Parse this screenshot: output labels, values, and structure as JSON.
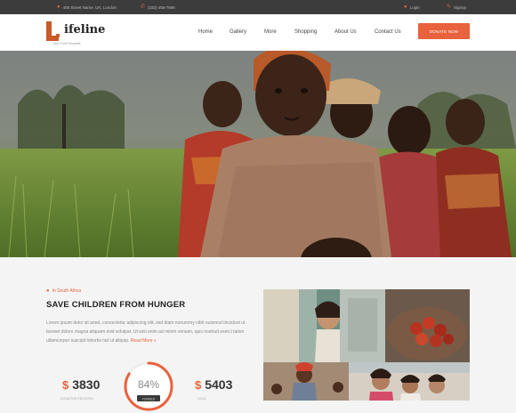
{
  "topbar": {
    "address": "405 Street Name, UK, London",
    "phone": "(333) 455-7866",
    "login": "Login",
    "signup": "Signup"
  },
  "header": {
    "logo_letter": "L",
    "brand": "ifeline",
    "tagline": "Non Profit Template",
    "nav": [
      "Home",
      "Gallery",
      "More",
      "Shopping",
      "About Us",
      "Contact Us"
    ],
    "donate": "DONATE NOW"
  },
  "content": {
    "location": "In South Africa",
    "title": "SAVE CHILDREN FROM HUNGER",
    "paragraph": "Lorem ipsum dolor sit amet, consectetur adipiscing elit, sed diam nonummy nibh euismod tincidunt ut laoreet dolore magna aliquam erat volutpat. Ut wisi enim ad minim veniam, quis nostrud exerci tation ullamcorper suscipit lobortis nisl ut aliquip.",
    "read_more": "Read More »",
    "stats": [
      {
        "currency": "$",
        "value": "3830",
        "label": "DONATION RECEIVED"
      },
      {
        "percent": "84%",
        "label": "FUNDED"
      },
      {
        "currency": "$",
        "value": "5403",
        "label": "GOAL"
      }
    ],
    "progress_fraction": 0.84
  },
  "colors": {
    "accent": "#e8623d",
    "topbar": "#3c3c3c",
    "logo": "#c85a2b"
  }
}
